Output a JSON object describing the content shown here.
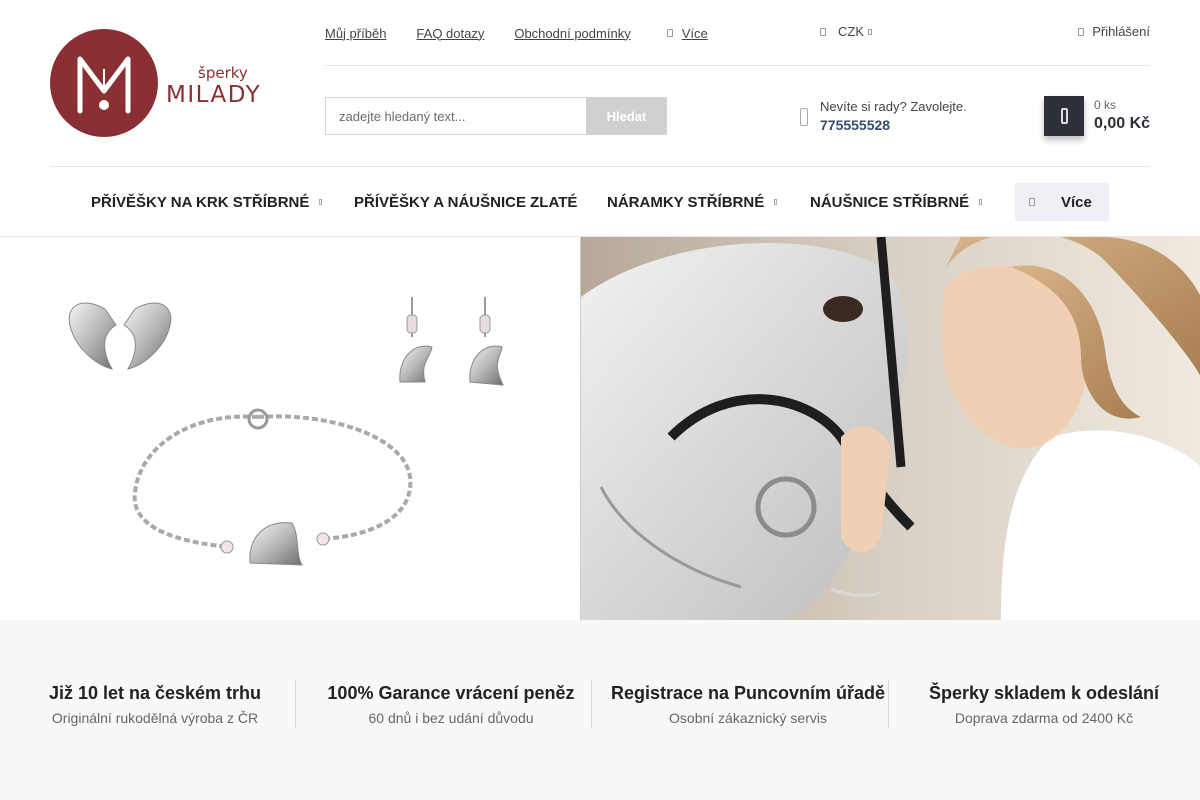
{
  "logo": {
    "small": "šperky",
    "big": "MILADY"
  },
  "top_links": [
    "Můj příběh",
    "FAQ dotazy",
    "Obchodní podmínky"
  ],
  "top_more": "Více",
  "currency": "CZK",
  "login": "Přihlášení",
  "search": {
    "placeholder": "zadejte hledaný text...",
    "button": "Hledat"
  },
  "phone": {
    "question": "Nevíte si rady? Zavolejte.",
    "number": "775555528"
  },
  "cart": {
    "count": "0 ks",
    "total": "0,00 Kč"
  },
  "nav": {
    "items": [
      "PŘÍVĚŠKY NA KRK STŘÍBRNÉ",
      "PŘÍVĚŠKY A NÁUŠNICE ZLATÉ",
      "NÁRAMKY STŘÍBRNÉ",
      "NÁUŠNICE STŘÍBRNÉ"
    ],
    "more": "Více"
  },
  "features": [
    {
      "title": "Již 10 let na českém trhu",
      "sub": "Originální rukodělná výroba z ČR"
    },
    {
      "title": "100% Garance vrácení peněz",
      "sub": "60 dnů i bez udání důvodu"
    },
    {
      "title": "Registrace na Puncovním úřadě",
      "sub": "Osobní zákaznický servis"
    },
    {
      "title": "Šperky skladem k odeslání",
      "sub": "Doprava zdarma od 2400 Kč"
    }
  ],
  "icons": [
    "logo-icon",
    "more-icon",
    "currency-icon",
    "user-icon",
    "phone-icon",
    "cart-icon",
    "chevron-down-icon",
    "menu-icon"
  ],
  "colors": {
    "brand": "#8a2f33",
    "cart": "#2d3038",
    "phone": "#374b6e",
    "features_bg": "#f8f8f9"
  }
}
